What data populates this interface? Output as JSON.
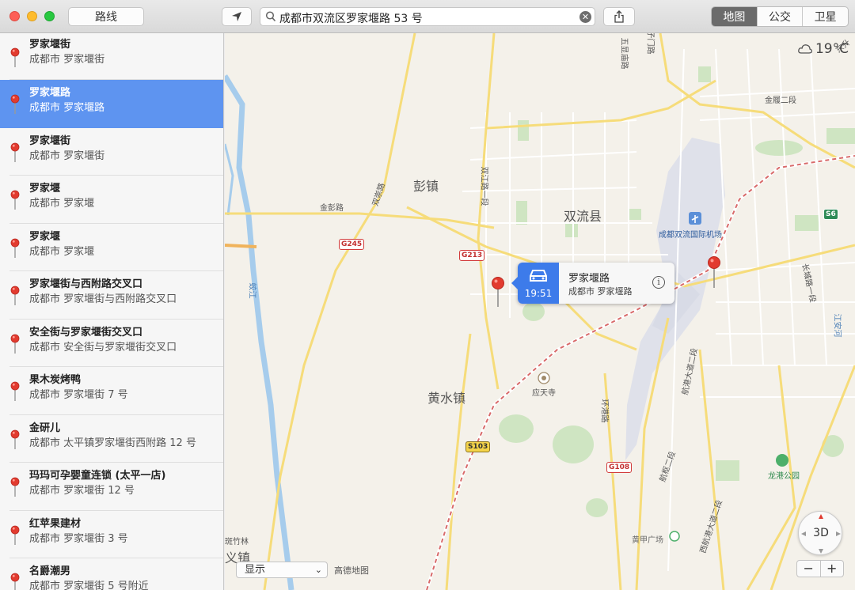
{
  "toolbar": {
    "route_label": "路线",
    "search_value": "成都市双流区罗家堰路 53 号",
    "map_types": [
      "地图",
      "公交",
      "卫星"
    ],
    "active_map_type": "地图"
  },
  "sidebar": {
    "items": [
      {
        "name": "罗家堰街",
        "addr": "成都市 罗家堰街"
      },
      {
        "name": "罗家堰路",
        "addr": "成都市 罗家堰路"
      },
      {
        "name": "罗家堰街",
        "addr": "成都市 罗家堰街"
      },
      {
        "name": "罗家堰",
        "addr": "成都市 罗家堰"
      },
      {
        "name": "罗家堰",
        "addr": "成都市 罗家堰"
      },
      {
        "name": "罗家堰街与西附路交叉口",
        "addr": "成都市 罗家堰街与西附路交叉口"
      },
      {
        "name": "安全街与罗家堰街交叉口",
        "addr": "成都市 安全街与罗家堰街交叉口"
      },
      {
        "name": "果木炭烤鸭",
        "addr": "成都市 罗家堰街 7 号"
      },
      {
        "name": "金研儿",
        "addr": "成都市 太平镇罗家堰街西附路 12 号"
      },
      {
        "name": "玛玛可孕婴童连锁 (太平一店)",
        "addr": "成都市 罗家堰街 12 号"
      },
      {
        "name": "红苹果建材",
        "addr": "成都市 罗家堰街 3 号"
      },
      {
        "name": "名爵潮男",
        "addr": "成都市 罗家堰街 5 号附近"
      }
    ],
    "selected_index": 1
  },
  "map": {
    "weather": "19°C",
    "labels": {
      "pengzhen": "彭镇",
      "shuangliu": "双流县",
      "huangshui": "黄水镇",
      "airport": "成都双流国际机场",
      "yingtiansi": "应天寺",
      "longgang_park": "龙港公园",
      "huangjia_plaza": "黄甲广场",
      "jinpeng_road": "金彭路",
      "shuangchuan_road": "双崇路",
      "shuangjiang_road": "双江路一段",
      "huanhu_road": "环港路",
      "hanggang_2": "航港大道二段",
      "hanggang_er": "航枢二段",
      "xihang_2": "西航港大道二段",
      "changcheng_1": "长城路一段",
      "jinhe_2": "金履二段",
      "wuguan_road": "五显庙路",
      "zi_men_road": "子门路",
      "jiaolou": "蛟江",
      "jiangan_he": "江安河",
      "dongsheng": "东升",
      "yi_zhen": "义镇",
      "banzhulin": "斑竹林"
    },
    "shields": {
      "g245": "G245",
      "g213": "G213",
      "s103": "S103",
      "g108": "G108",
      "s6": "S6"
    },
    "callout": {
      "title": "罗家堰路",
      "subtitle": "成都市 罗家堰路",
      "drive_time": "19:51"
    },
    "compass_label": "3D",
    "show_label": "显示",
    "credit": "高德地图",
    "zoom_out": "−",
    "zoom_in": "+"
  }
}
